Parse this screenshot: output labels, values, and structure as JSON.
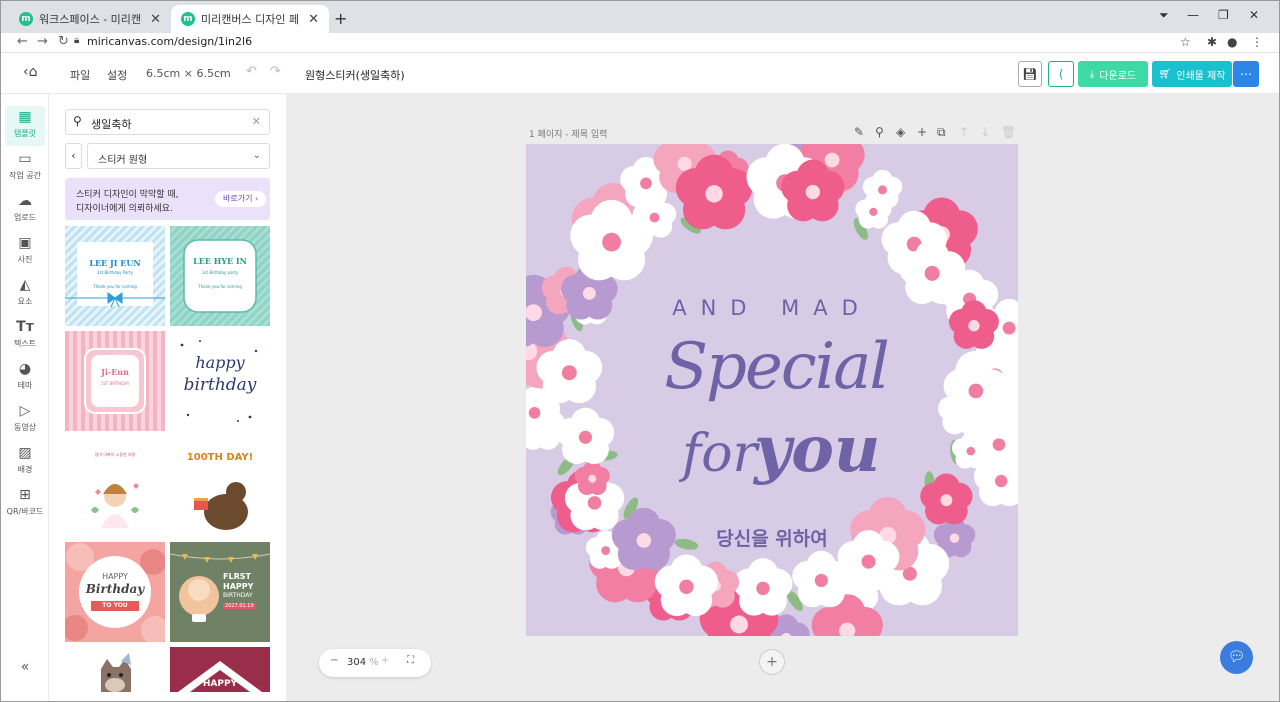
{
  "browser": {
    "tabs": [
      {
        "favicon": "m",
        "title": "워크스페이스 - 미리캔버스",
        "close": "✕"
      },
      {
        "favicon": "m",
        "title": "미리캔버스 디자인 페이지",
        "close": "✕"
      }
    ],
    "new_tab": "+",
    "url": "miricanvas.com/design/1in2l6"
  },
  "header": {
    "menu_file": "파일",
    "menu_settings": "설정",
    "size": "6.5cm × 6.5cm",
    "doc_title": "원형스티커(생일축하)",
    "download_label": "다운로드",
    "print_label": "인쇄물 제작",
    "more_label": "⋯",
    "colors": {
      "download": "#3ed9a5",
      "print": "#19c1cf",
      "more": "#2b86e8",
      "accent": "#14b18a"
    }
  },
  "rail": [
    {
      "label": "템플릿",
      "icon": "template-icon",
      "active": true
    },
    {
      "label": "작업 공간",
      "icon": "archive-icon"
    },
    {
      "label": "업로드",
      "icon": "upload-icon"
    },
    {
      "label": "사진",
      "icon": "photo-icon"
    },
    {
      "label": "요소",
      "icon": "elements-icon"
    },
    {
      "label": "텍스트",
      "icon": "text-icon"
    },
    {
      "label": "테마",
      "icon": "palette-icon"
    },
    {
      "label": "동영상",
      "icon": "video-icon"
    },
    {
      "label": "배경",
      "icon": "background-icon"
    },
    {
      "label": "QR/바코드",
      "icon": "qr-icon"
    }
  ],
  "panel": {
    "search_value": "생일축하",
    "category": "스티커 원형",
    "promo_line1": "스티커 디자인이 막막할 때,",
    "promo_line2": "디자이너에게 의뢰하세요.",
    "promo_button": "바로가기 ›"
  },
  "thumbs": [
    {
      "line1": "LEE JI EUN",
      "line2": "1st Birthday Party",
      "line3": "Thank you for coming"
    },
    {
      "line1": "LEE HYE IN",
      "line2": "1st Birthday party",
      "line3": "Thank you for coming"
    },
    {
      "line1": "Ji-Eun",
      "line2": "1ST BIRTHDAY"
    },
    {
      "line1": "happy",
      "line2": "birthday"
    },
    {
      "line1": "엄마 아빠의 소중한 보물"
    },
    {
      "line1": "100TH DAY!"
    },
    {
      "line1": "HAPPY",
      "line2": "Birthday",
      "line3": "TO YOU"
    },
    {
      "line1": "FLRST",
      "line2": "HAPPY",
      "line3": "BIRTHDAY",
      "line4": "2027.01.19"
    },
    {},
    {
      "line1": "HAPPY"
    }
  ],
  "canvas": {
    "page_label": "1 페이지",
    "page_title_placeholder": "제목 입력",
    "arc_text": "AND MAD",
    "text_special": "Special",
    "text_for": "for",
    "text_you": "you",
    "text_korean": "당신을 위하여",
    "zoom": "304",
    "zoom_unit": "%",
    "colors": {
      "background": "#d8cbe5",
      "script": "#6d63a6"
    }
  }
}
